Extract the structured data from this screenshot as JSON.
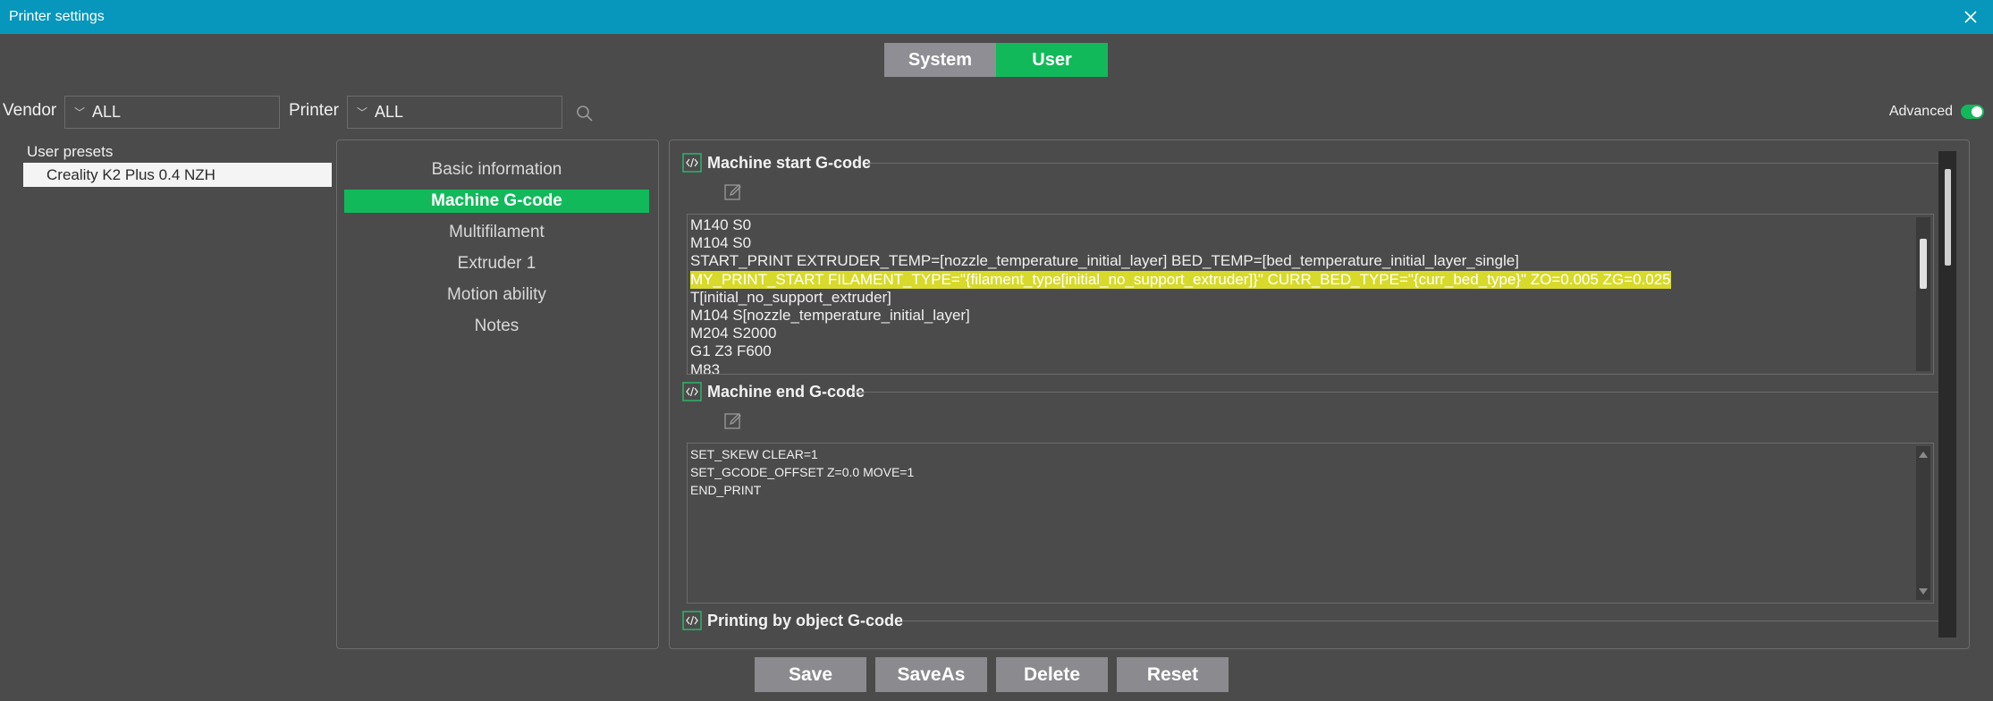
{
  "window": {
    "title": "Printer settings",
    "close_icon": "close-icon"
  },
  "mode_toggle": {
    "system_label": "System",
    "user_label": "User",
    "active": "User",
    "active_color": "#12b95a"
  },
  "filters": {
    "vendor_label": "Vendor",
    "vendor_value": "ALL",
    "printer_label": "Printer",
    "printer_value": "ALL",
    "search_icon": "search-icon"
  },
  "advanced": {
    "label": "Advanced",
    "enabled": true
  },
  "presets": {
    "heading": "User presets",
    "items": [
      {
        "label": "Creality K2 Plus 0.4 NZH",
        "selected": true
      }
    ]
  },
  "tabs": [
    {
      "label": "Basic information",
      "active": false
    },
    {
      "label": "Machine G-code",
      "active": true
    },
    {
      "label": "Multifilament",
      "active": false
    },
    {
      "label": "Extruder 1",
      "active": false
    },
    {
      "label": "Motion ability",
      "active": false
    },
    {
      "label": "Notes",
      "active": false
    }
  ],
  "sections": {
    "start": {
      "title": "Machine start G-code",
      "lines": [
        "M140 S0",
        "M104 S0",
        "START_PRINT EXTRUDER_TEMP=[nozzle_temperature_initial_layer] BED_TEMP=[bed_temperature_initial_layer_single]",
        "MY_PRINT_START FILAMENT_TYPE=\"{filament_type[initial_no_support_extruder]}\" CURR_BED_TYPE=\"{curr_bed_type}\" ZO=0.005 ZG=0.025",
        "T[initial_no_support_extruder]",
        "M104 S[nozzle_temperature_initial_layer]",
        "M204 S2000",
        "G1 Z3 F600",
        "M83"
      ],
      "highlighted_line": 3
    },
    "end": {
      "title": "Machine end G-code",
      "lines": [
        "SET_SKEW CLEAR=1",
        "SET_GCODE_OFFSET Z=0.0 MOVE=1",
        "END_PRINT"
      ]
    },
    "by_object": {
      "title": "Printing by object G-code"
    }
  },
  "buttons": {
    "save": "Save",
    "save_as": "SaveAs",
    "delete": "Delete",
    "reset": "Reset"
  }
}
